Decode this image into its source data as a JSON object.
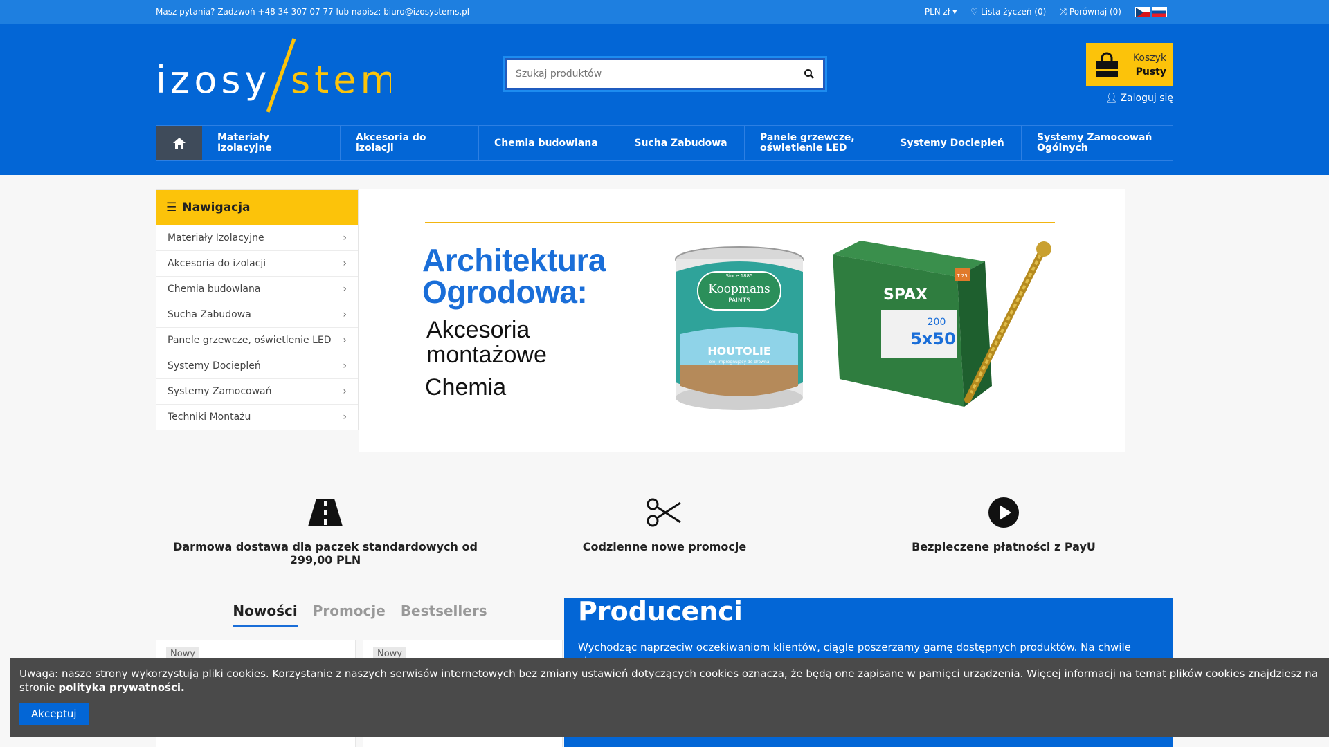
{
  "topbar": {
    "contact": "Masz pytania? Zadzwoń +48 34 307 07 77 lub napisz: biuro@izosystems.pl",
    "currency": "PLN zł",
    "wishlist": "Lista życzeń (0)",
    "compare": "Porównaj (0)"
  },
  "header": {
    "logo_text_left": "izosy",
    "logo_text_right": "stems",
    "search_placeholder": "Szukaj produktów",
    "cart_label": "Koszyk",
    "cart_status": "Pusty",
    "login": "Zaloguj się"
  },
  "mainnav": [
    {
      "label": "Materiały Izolacyjne"
    },
    {
      "label": "Akcesoria do izolacji"
    },
    {
      "label": "Chemia budowlana"
    },
    {
      "label": "Sucha Zabudowa"
    },
    {
      "label": "Panele grzewcze, oświetlenie LED"
    },
    {
      "label": "Systemy Dociepleń"
    },
    {
      "label": "Systemy Zamocowań Ogólnych"
    }
  ],
  "sidebar": {
    "title": "Nawigacja",
    "items": [
      "Materiały Izolacyjne",
      "Akcesoria do izolacji",
      "Chemia budowlana",
      "Sucha Zabudowa",
      "Panele grzewcze, oświetlenie LED",
      "Systemy Dociepleń",
      "Systemy Zamocowań",
      "Techniki Montażu"
    ]
  },
  "banner": {
    "title_line1": "Architektura",
    "title_line2": "Ogrodowa:",
    "sub_line1": "Akcesoria",
    "sub_line2": "montażowe",
    "sub_line3": "Chemia",
    "paint_brand": "Koopmans",
    "paint_brand2": "PAINTS",
    "paint_since": "Since 1885",
    "paint_product": "HOUTOLIE",
    "paint_desc": "olej impregnujący do drewna",
    "box_brand": "SPAX",
    "box_qty": "200",
    "box_size": "5x50",
    "box_code": "T 25"
  },
  "features": [
    {
      "icon": "road-icon",
      "text": "Darmowa dostawa dla paczek standardowych od 299,00 PLN"
    },
    {
      "icon": "scissors-icon",
      "text": "Codzienne nowe promocje"
    },
    {
      "icon": "play-circle-icon",
      "text": "Bezpieczene płatności z PayU"
    }
  ],
  "tabs": [
    "Nowości",
    "Promocje",
    "Bestsellers"
  ],
  "products": [
    {
      "badge": "Nowy"
    },
    {
      "badge": "Nowy"
    }
  ],
  "producers": {
    "title": "Producenci",
    "text": "Wychodząc naprzeciw oczekiwaniom klientów, ciągle poszerzamy gamę dostępnych produktów. Na chwile obecną w"
  },
  "cookie": {
    "text": "Uwaga: nasze strony wykorzystują pliki cookies. Korzystanie z naszych serwisów internetowych bez zmiany ustawień dotyczących cookies oznacza, że będą one zapisane w pamięci urządzenia. Więcej informacji na temat plików cookies znajdziesz na stronie",
    "link": "polityka prywatności.",
    "button": "Akceptuj"
  },
  "colors": {
    "brand_blue": "#0366d6",
    "accent_yellow": "#fcc30a"
  }
}
